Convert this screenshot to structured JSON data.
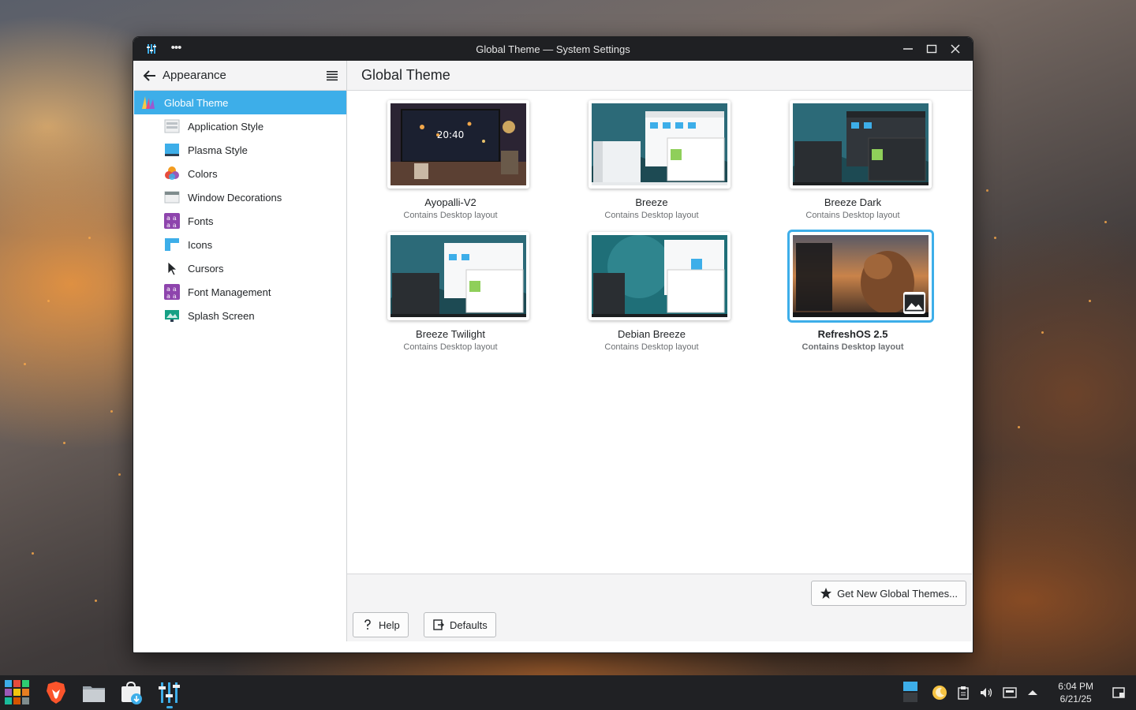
{
  "window": {
    "title": "Global Theme — System Settings",
    "more_label": "•••"
  },
  "sidebar": {
    "header": "Appearance",
    "items": [
      {
        "label": "Global Theme",
        "icon": "global-theme-icon",
        "active": true
      },
      {
        "label": "Application Style",
        "icon": "application-style-icon"
      },
      {
        "label": "Plasma Style",
        "icon": "plasma-style-icon"
      },
      {
        "label": "Colors",
        "icon": "colors-icon"
      },
      {
        "label": "Window Decorations",
        "icon": "window-decorations-icon"
      },
      {
        "label": "Fonts",
        "icon": "fonts-icon"
      },
      {
        "label": "Icons",
        "icon": "icons-icon"
      },
      {
        "label": "Cursors",
        "icon": "cursors-icon"
      },
      {
        "label": "Font Management",
        "icon": "font-management-icon"
      },
      {
        "label": "Splash Screen",
        "icon": "splash-screen-icon"
      }
    ]
  },
  "main": {
    "title": "Global Theme",
    "themes": [
      {
        "name": "Ayopalli-V2",
        "subtitle": "Contains Desktop layout",
        "clock": "20:40"
      },
      {
        "name": "Breeze",
        "subtitle": "Contains Desktop layout"
      },
      {
        "name": "Breeze Dark",
        "subtitle": "Contains Desktop layout"
      },
      {
        "name": "Breeze Twilight",
        "subtitle": "Contains Desktop layout"
      },
      {
        "name": "Debian Breeze",
        "subtitle": "Contains Desktop layout"
      },
      {
        "name": "RefreshOS 2.5",
        "subtitle": "Contains Desktop layout",
        "selected": true
      }
    ]
  },
  "footer": {
    "get_new": "Get New Global Themes...",
    "help": "Help",
    "defaults": "Defaults"
  },
  "taskbar": {
    "time": "6:04 PM",
    "date": "6/21/25"
  },
  "colors": {
    "accent": "#3daee9",
    "titlebar": "#1f2023",
    "taskbar": "#202124"
  }
}
